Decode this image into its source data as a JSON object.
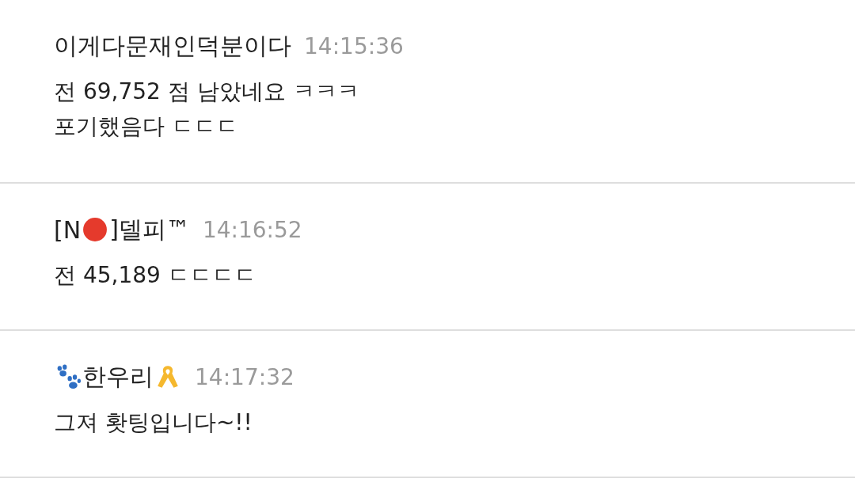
{
  "comments": [
    {
      "name": [
        {
          "kind": "text",
          "text": "이게다문재인덕분이다"
        }
      ],
      "time": "14:15:36",
      "message": "전 69,752 점 남았네요 ㅋㅋㅋ\n포기했음다 ㄷㄷㄷ"
    },
    {
      "name": [
        {
          "kind": "text",
          "text": "[N"
        },
        {
          "kind": "red-dot"
        },
        {
          "kind": "text",
          "text": "]델피™"
        }
      ],
      "time": "14:16:52",
      "message": "전 45,189 ㄷㄷㄷㄷ"
    },
    {
      "name": [
        {
          "kind": "paw"
        },
        {
          "kind": "text",
          "text": "한우리"
        },
        {
          "kind": "ribbon"
        }
      ],
      "time": "14:17:32",
      "message": "그져 홧팅입니다~!!"
    }
  ]
}
